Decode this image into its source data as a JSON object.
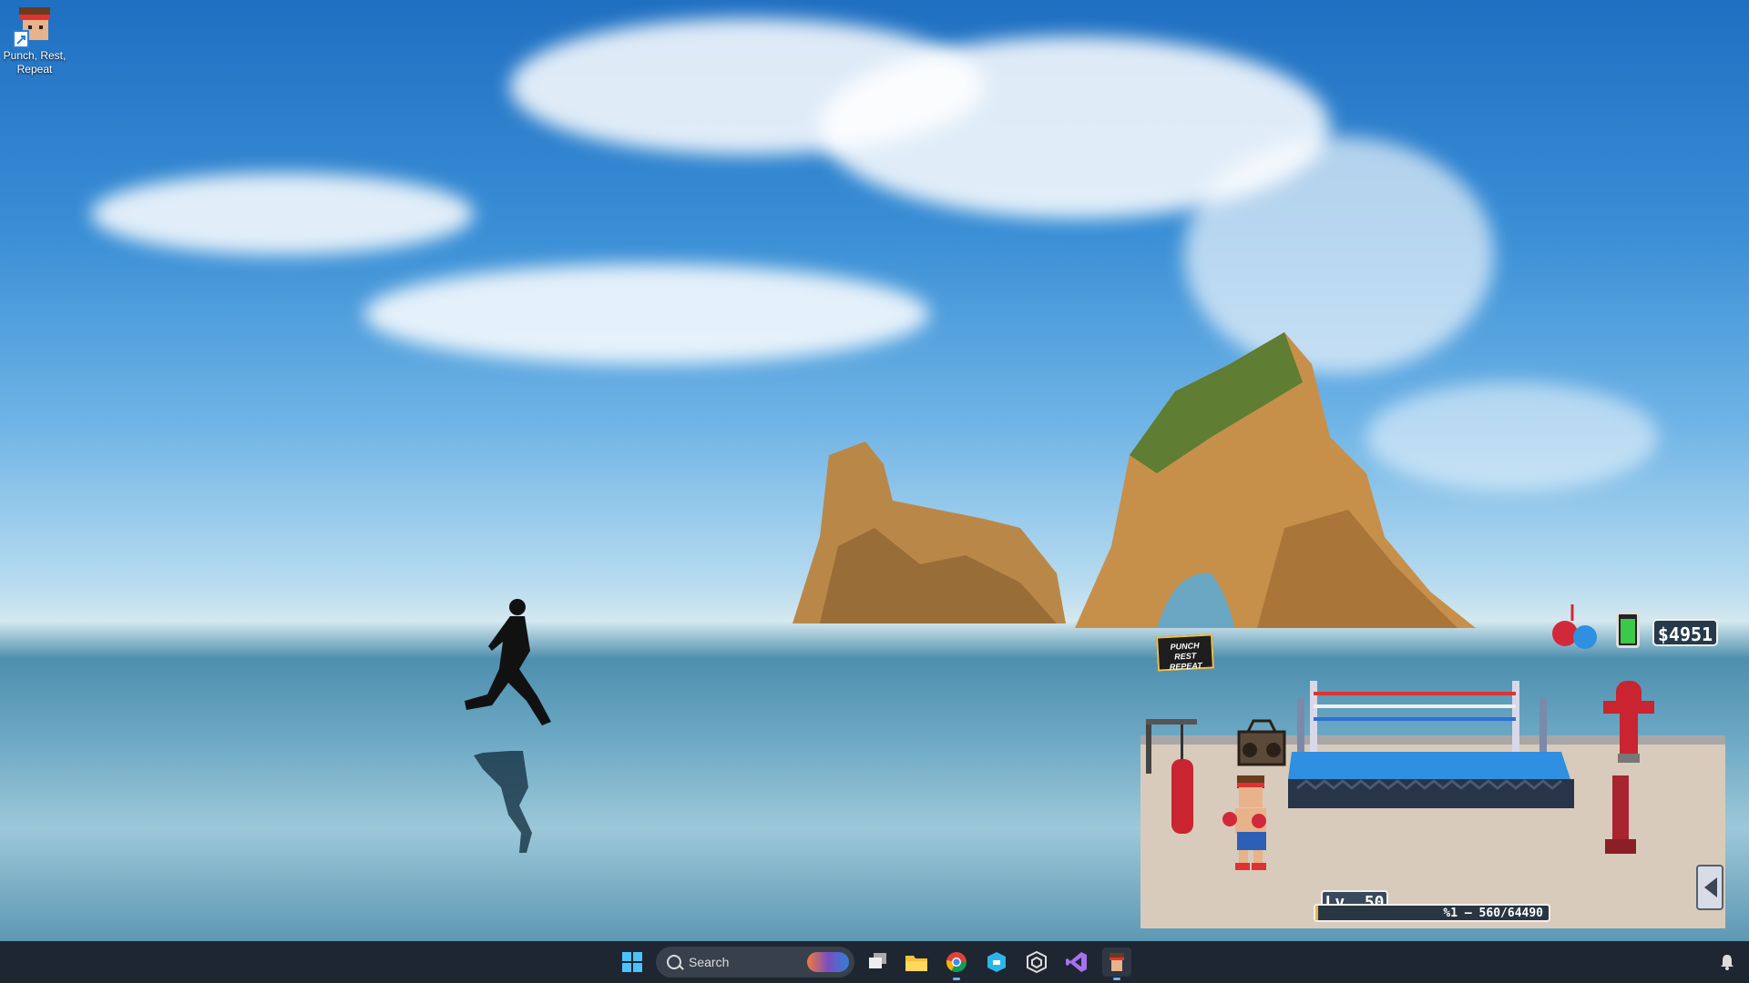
{
  "desktop": {
    "icons": [
      {
        "label": "Punch, Rest, Repeat"
      }
    ]
  },
  "game": {
    "money": "$4951",
    "level": "Lv. 50",
    "xp_text": "%1 — 560/64490",
    "xp_progress": 0.0087,
    "logo_text": "PUNCH REST REPEAT",
    "energy_level": 0.85
  },
  "taskbar": {
    "search_placeholder": "Search",
    "apps": [
      {
        "icon": "windows-start-icon"
      },
      {
        "icon": "task-view-icon"
      },
      {
        "icon": "file-explorer-icon"
      },
      {
        "icon": "chrome-icon"
      },
      {
        "icon": "hex-app-icon"
      },
      {
        "icon": "unity-icon"
      },
      {
        "icon": "visual-studio-icon"
      },
      {
        "icon": "punch-rest-repeat-icon"
      }
    ],
    "notification_icon": "bell-icon"
  }
}
